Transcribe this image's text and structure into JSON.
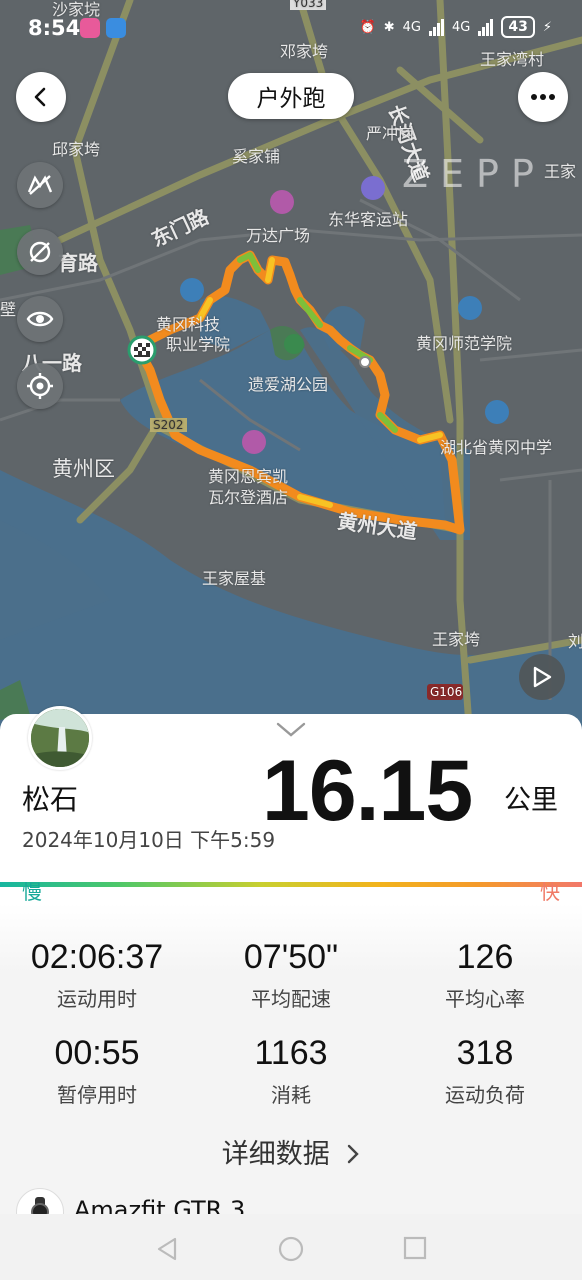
{
  "status_bar": {
    "time": "8:54",
    "network_1": "4G",
    "network_2": "4G",
    "battery": "43"
  },
  "header": {
    "title": "户外跑",
    "watermark": "ZEPP"
  },
  "map": {
    "labels": {
      "shajiawan": "沙家垸",
      "y033": "Y033",
      "dengjiawan": "邓家垮",
      "wangjiawancun": "王家湾村",
      "changhedadao": "长河大道",
      "qiujiawan": "邱家垮",
      "yanchonggang": "严冲岗",
      "xijiapu": "奚家铺",
      "wangjia_right": "王家",
      "dongmenlu": "东门路",
      "wandaguangchang": "万达广场",
      "donghuakeyunzhan": "东华客运站",
      "yuyulu": "育路",
      "bi": "壁",
      "huanggangkeji": "黄冈科技",
      "zhiyexueyuan": "职业学院",
      "huangganshifan": "黄冈师范学院",
      "bayilu": "八一路",
      "yiaihu": "遗爱湖公园",
      "s2_road": "S202",
      "hubeihuanggangzhongxue": "湖北省黄冈中学",
      "huangzhouqu": "黄州区",
      "binguan_1": "黄冈恩宾凯",
      "binguan_2": "瓦尔登酒店",
      "huangzhoudadao": "黄州大道",
      "wangjiawuji": "王家屋基",
      "wangjiawan": "王家垮",
      "g106": "G106",
      "liu": "刘"
    },
    "icons": [
      "back-icon",
      "more-icon",
      "layers-off-icon",
      "hide-poi-icon",
      "eye-icon",
      "locate-icon",
      "play-icon"
    ]
  },
  "summary": {
    "user_name": "松石",
    "datetime": "2024年10月10日 下午5:59",
    "distance": "16.15",
    "distance_unit": "公里",
    "pace_slow": "慢",
    "pace_fast": "快"
  },
  "stats": [
    {
      "value": "02:06:37",
      "label": "运动用时"
    },
    {
      "value": "07'50\"",
      "label": "平均配速"
    },
    {
      "value": "126",
      "label": "平均心率"
    },
    {
      "value": "00:55",
      "label": "暂停用时"
    },
    {
      "value": "1163",
      "label": "消耗"
    },
    {
      "value": "318",
      "label": "运动负荷"
    }
  ],
  "detail_link": "详细数据",
  "device": {
    "name": "Amazfit GTR 3"
  },
  "colors": {
    "route": "#f28b1e",
    "route_fast": "#f7a324",
    "route_slow": "#7dbf3a",
    "water": "#4a6f8c",
    "land": "#5d6468",
    "road": "#8c8f62"
  }
}
